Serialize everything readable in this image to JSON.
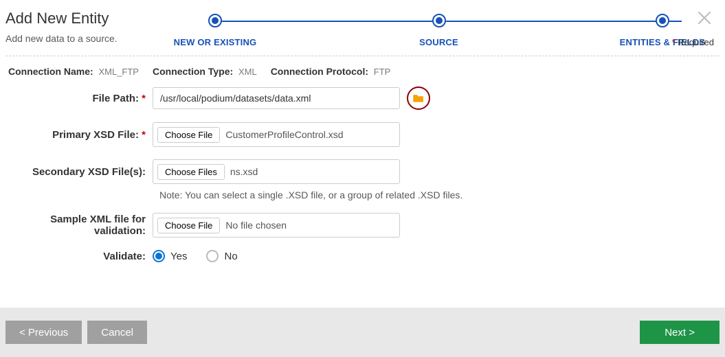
{
  "header": {
    "title": "Add New Entity",
    "subtitle": "Add new data to a source.",
    "required_label": "Required",
    "steps": [
      "NEW OR EXISTING",
      "SOURCE",
      "ENTITIES & FIELDS"
    ]
  },
  "connection": {
    "name_label": "Connection Name:",
    "name_value": "XML_FTP",
    "type_label": "Connection Type:",
    "type_value": "XML",
    "protocol_label": "Connection Protocol:",
    "protocol_value": "FTP"
  },
  "form": {
    "file_path_label": "File Path:",
    "file_path_value": "/usr/local/podium/datasets/data.xml",
    "primary_xsd_label": "Primary XSD File:",
    "primary_xsd_button": "Choose File",
    "primary_xsd_file": "CustomerProfileControl.xsd",
    "secondary_xsd_label": "Secondary XSD File(s):",
    "secondary_xsd_button": "Choose Files",
    "secondary_xsd_file": "ns.xsd",
    "secondary_note": "Note: You can select a single .XSD file, or a group of related .XSD files.",
    "sample_xml_label": "Sample XML file for validation:",
    "sample_xml_button": "Choose File",
    "sample_xml_file": "No file chosen",
    "validate_label": "Validate:",
    "validate_yes": "Yes",
    "validate_no": "No"
  },
  "footer": {
    "previous": "< Previous",
    "cancel": "Cancel",
    "next": "Next >"
  }
}
